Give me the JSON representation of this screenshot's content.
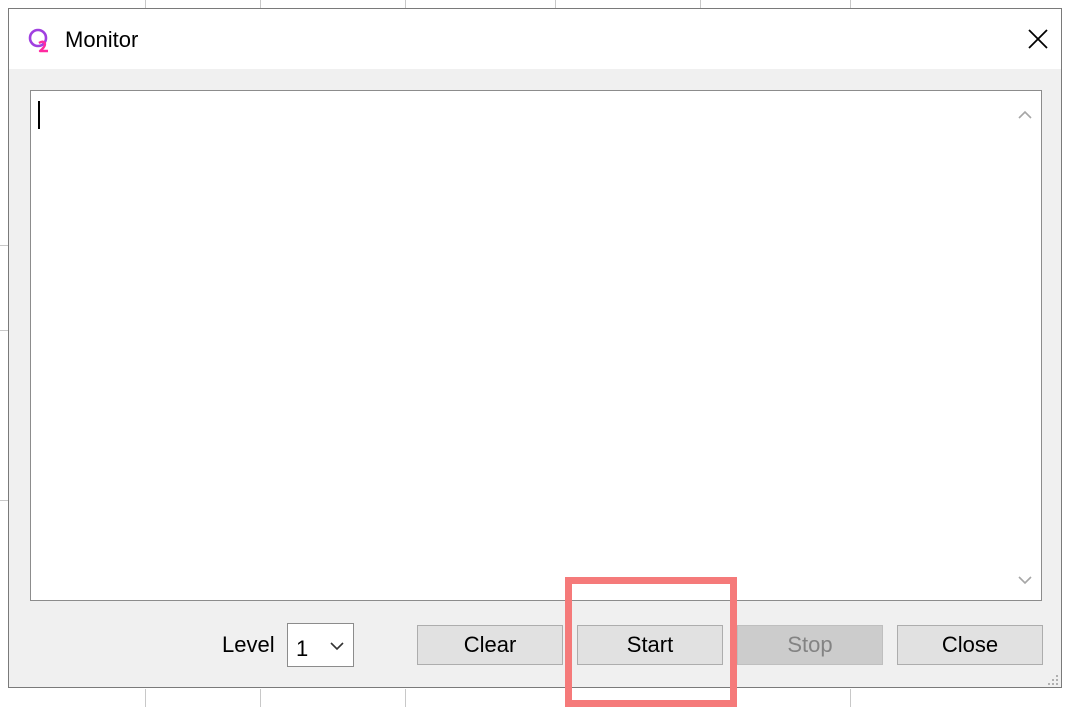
{
  "window": {
    "title": "Monitor"
  },
  "monitor": {
    "text": ""
  },
  "level": {
    "label": "Level",
    "selected": "1"
  },
  "buttons": {
    "clear": "Clear",
    "start": "Start",
    "stop": "Stop",
    "close": "Close"
  },
  "icons": {
    "app": "q2-app-icon",
    "close": "close-icon",
    "scroll_up": "chevron-up-icon",
    "scroll_down": "chevron-down-icon",
    "dropdown": "chevron-down-icon",
    "grip": "resize-grip-icon"
  },
  "colors": {
    "icon_purple": "#a040e0",
    "icon_pink": "#ff2aa0",
    "highlight": "#f57a7a",
    "disabled_text": "#838383"
  },
  "state": {
    "stop_disabled": true
  }
}
